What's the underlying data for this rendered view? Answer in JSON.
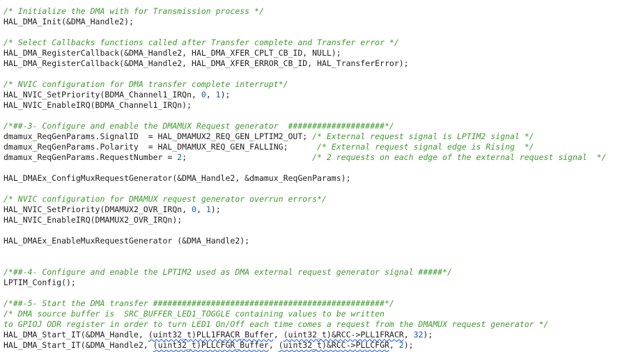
{
  "editor": {
    "lines": [
      [
        {
          "t": "/* Initialize the DMA with for Transmission process */",
          "s": "cmt"
        }
      ],
      [
        {
          "t": "HAL_DMA_Init(&DMA_Handle2);",
          "s": ""
        }
      ],
      [],
      [
        {
          "t": "/* Select Callbacks functions called after Transfer complete and Transfer error */",
          "s": "cmt"
        }
      ],
      [
        {
          "t": "HAL_DMA_RegisterCallback(&DMA_Handle2, HAL_DMA_XFER_CPLT_CB_ID, NULL);",
          "s": ""
        }
      ],
      [
        {
          "t": "HAL_DMA_RegisterCallback(&DMA_Handle2, HAL_DMA_XFER_ERROR_CB_ID, HAL_TransferError);",
          "s": ""
        }
      ],
      [],
      [
        {
          "t": "/* NVIC configuration for DMA transfer complete interrupt*/",
          "s": "cmt"
        }
      ],
      [
        {
          "t": "HAL_NVIC_SetPriority(BDMA_Channel1_IRQn, ",
          "s": ""
        },
        {
          "t": "0",
          "s": "num"
        },
        {
          "t": ", ",
          "s": ""
        },
        {
          "t": "1",
          "s": "num"
        },
        {
          "t": ");",
          "s": ""
        }
      ],
      [
        {
          "t": "HAL_NVIC_EnableIRQ(BDMA_Channel1_IRQn);",
          "s": ""
        }
      ],
      [],
      [
        {
          "t": "/*##-3- Configure and enable the DMAMUX Request generator  ####################*/",
          "s": "cmt"
        }
      ],
      [
        {
          "t": "dmamux_ReqGenParams.SignalID  = HAL_DMAMUX2_REQ_GEN_LPTIM2_OUT; ",
          "s": ""
        },
        {
          "t": "/* External request signal is LPTIM2 signal */",
          "s": "cmt"
        }
      ],
      [
        {
          "t": "dmamux_ReqGenParams.Polarity  = HAL_DMAMUX_REQ_GEN_FALLING;      ",
          "s": ""
        },
        {
          "t": "/* External request signal edge is Rising  */",
          "s": "cmt"
        }
      ],
      [
        {
          "t": "dmamux_ReqGenParams.RequestNumber = ",
          "s": ""
        },
        {
          "t": "2",
          "s": "num"
        },
        {
          "t": ";                          ",
          "s": ""
        },
        {
          "t": "/* 2 requests on each edge of the external request signal  */",
          "s": "cmt"
        }
      ],
      [],
      [
        {
          "t": "HAL_DMAEx_ConfigMuxRequestGenerator(&DMA_Handle2, &dmamux_ReqGenParams);",
          "s": ""
        }
      ],
      [],
      [
        {
          "t": "/* NVIC configuration for DMAMUX request generator overrun errors*/",
          "s": "cmt"
        }
      ],
      [
        {
          "t": "HAL_NVIC_SetPriority(DMAMUX2_OVR_IRQn, ",
          "s": ""
        },
        {
          "t": "0",
          "s": "num"
        },
        {
          "t": ", ",
          "s": ""
        },
        {
          "t": "1",
          "s": "num"
        },
        {
          "t": ");",
          "s": ""
        }
      ],
      [
        {
          "t": "HAL_NVIC_EnableIRQ(DMAMUX2_OVR_IRQn);",
          "s": ""
        }
      ],
      [],
      [
        {
          "t": "HAL_DMAEx_EnableMuxRequestGenerator (&DMA_Handle2);",
          "s": ""
        }
      ],
      [],
      [],
      [
        {
          "t": "/*##-4- Configure and enable the LPTIM2 used as DMA external request generator signal #####*/",
          "s": "cmt"
        }
      ],
      [
        {
          "t": "LPTIM_Config();",
          "s": ""
        }
      ],
      [],
      [
        {
          "t": "/*##-5- Start the DMA transfer ################################################*/",
          "s": "cmt"
        }
      ],
      [
        {
          "t": "/* DMA source buffer is  SRC_BUFFER_LED1_TOGGLE containing values to be written",
          "s": "cmt"
        }
      ],
      [
        {
          "t": "to GPIOJ ODR register in order to turn LED1 On/Off each time comes a request from the DMAMUX request generator */",
          "s": "cmt"
        }
      ],
      [
        {
          "t": "HAL_DMA_Start_IT(&DMA_Handle, ",
          "s": ""
        },
        {
          "t": "(uint32_t)PLL1FRACR_Buffer",
          "s": "sq"
        },
        {
          "t": ", ",
          "s": ""
        },
        {
          "t": "(uint32_t)&RCC->PLL1FRACR",
          "s": "sq"
        },
        {
          "t": ", ",
          "s": ""
        },
        {
          "t": "32",
          "s": "num"
        },
        {
          "t": ");",
          "s": ""
        }
      ],
      [
        {
          "t": "HAL_DMA_Start_IT(&DMA_Handle2, ",
          "s": ""
        },
        {
          "t": "(uint32_t)PLLCFGR_Buffer",
          "s": "sq"
        },
        {
          "t": ", ",
          "s": ""
        },
        {
          "t": "(uint32_t)&RCC->PLLCFGR",
          "s": "sq"
        },
        {
          "t": ", ",
          "s": ""
        },
        {
          "t": "2",
          "s": "num"
        },
        {
          "t": ");",
          "s": ""
        }
      ]
    ]
  }
}
